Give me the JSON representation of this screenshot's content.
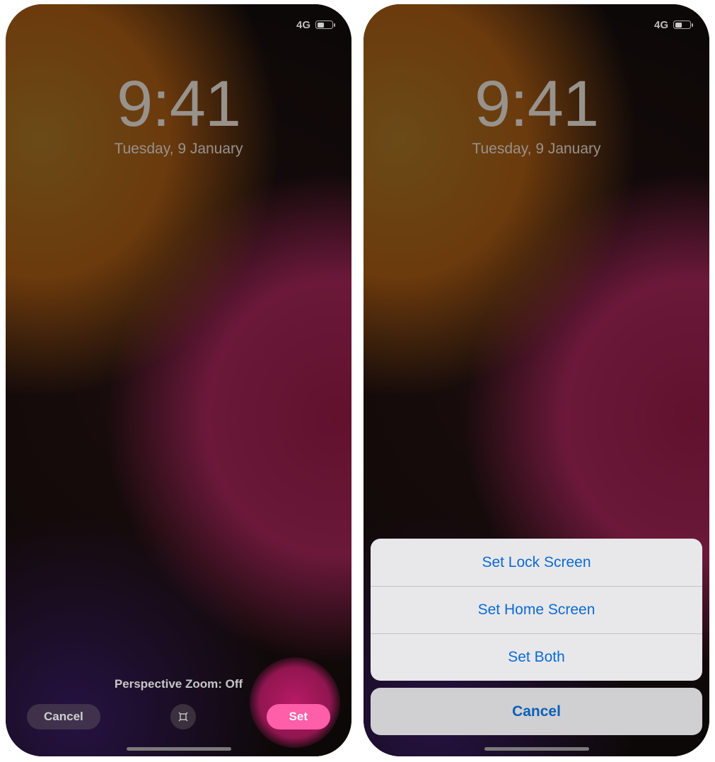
{
  "status": {
    "network": "4G"
  },
  "clock": {
    "time": "9:41",
    "date": "Tuesday, 9 January"
  },
  "left_screen": {
    "perspective_label": "Perspective Zoom: Off",
    "cancel": "Cancel",
    "set": "Set"
  },
  "right_screen": {
    "action_sheet": {
      "lock": "Set Lock Screen",
      "home": "Set Home Screen",
      "both": "Set Both",
      "cancel": "Cancel"
    }
  }
}
